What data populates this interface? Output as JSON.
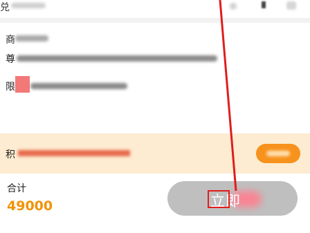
{
  "header": {
    "title": "兑"
  },
  "description": {
    "line1_char": "商",
    "line2_char": "尊",
    "line2_text": "",
    "line3_char": "限",
    "line3_text": ""
  },
  "ribbon": {
    "label": "积",
    "warning_text": "",
    "button_label": ""
  },
  "footer": {
    "total_label": "合计",
    "total_value": "49000",
    "total_unit": "",
    "submit_label": "立即"
  },
  "colors": {
    "accent": "#f29200",
    "ribbon_bg": "#fdecd1",
    "annotation": "#e01d1d",
    "button_disabled": "#bfbfbf"
  },
  "icons": [
    "share-icon",
    "more-icon"
  ]
}
